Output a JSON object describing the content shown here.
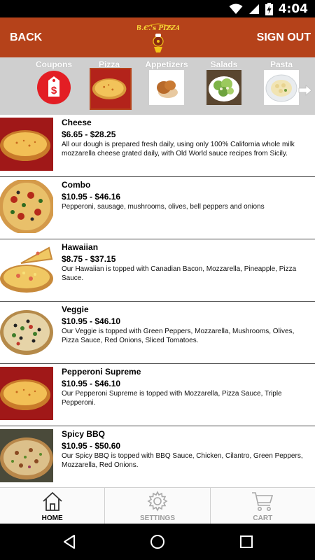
{
  "status_bar": {
    "time": "4:04"
  },
  "header": {
    "back_label": "BACK",
    "sign_out_label": "SIGN OUT",
    "logo_text": "B.C.'s PIZZA"
  },
  "categories": [
    {
      "label": "Coupons",
      "icon": "coupon-tag-icon",
      "selected": false
    },
    {
      "label": "Pizza",
      "icon": "pizza-thumbnail",
      "selected": true
    },
    {
      "label": "Appetizers",
      "icon": "appetizer-thumbnail",
      "selected": false
    },
    {
      "label": "Salads",
      "icon": "salad-thumbnail",
      "selected": false
    },
    {
      "label": "Pasta",
      "icon": "pasta-thumbnail",
      "selected": false
    }
  ],
  "menu_items": [
    {
      "name": "Cheese",
      "price": "$6.65 - $28.25",
      "description": "All our dough is prepared fresh daily, using only 100% California whole milk mozzarella cheese grated daily, with Old World sauce recipes from Sicily."
    },
    {
      "name": "Combo",
      "price": "$10.95 - $46.16",
      "description": "Pepperoni, sausage, mushrooms, olives, bell peppers and onions"
    },
    {
      "name": "Hawaiian",
      "price": "$8.75 - $37.15",
      "description": "Our Hawaiian  is topped with Canadian Bacon, Mozzarella, Pineapple, Pizza Sauce."
    },
    {
      "name": "Veggie",
      "price": "$10.95 - $46.10",
      "description": "Our Veggie  is topped with Green Peppers, Mozzarella, Mushrooms, Olives, Pizza Sauce, Red Onions, Sliced Tomatoes."
    },
    {
      "name": "Pepperoni Supreme",
      "price": "$10.95 - $46.10",
      "description": "Our Pepperoni Supreme  is topped with Mozzarella, Pizza Sauce, Triple Pepperoni."
    },
    {
      "name": "Spicy BBQ",
      "price": "$10.95 - $50.60",
      "description": "Our Spicy BBQ  is topped with BBQ Sauce, Chicken, Cilantro, Green Peppers, Mozzarella, Red Onions."
    }
  ],
  "tabs": [
    {
      "label": "HOME",
      "icon": "home-icon",
      "active": true
    },
    {
      "label": "SETTINGS",
      "icon": "gear-icon",
      "active": false
    },
    {
      "label": "CART",
      "icon": "cart-icon",
      "active": false
    }
  ],
  "colors": {
    "header": "#b5421a",
    "category_strip": "#cfcfcf",
    "coupon_badge": "#e31e24"
  }
}
